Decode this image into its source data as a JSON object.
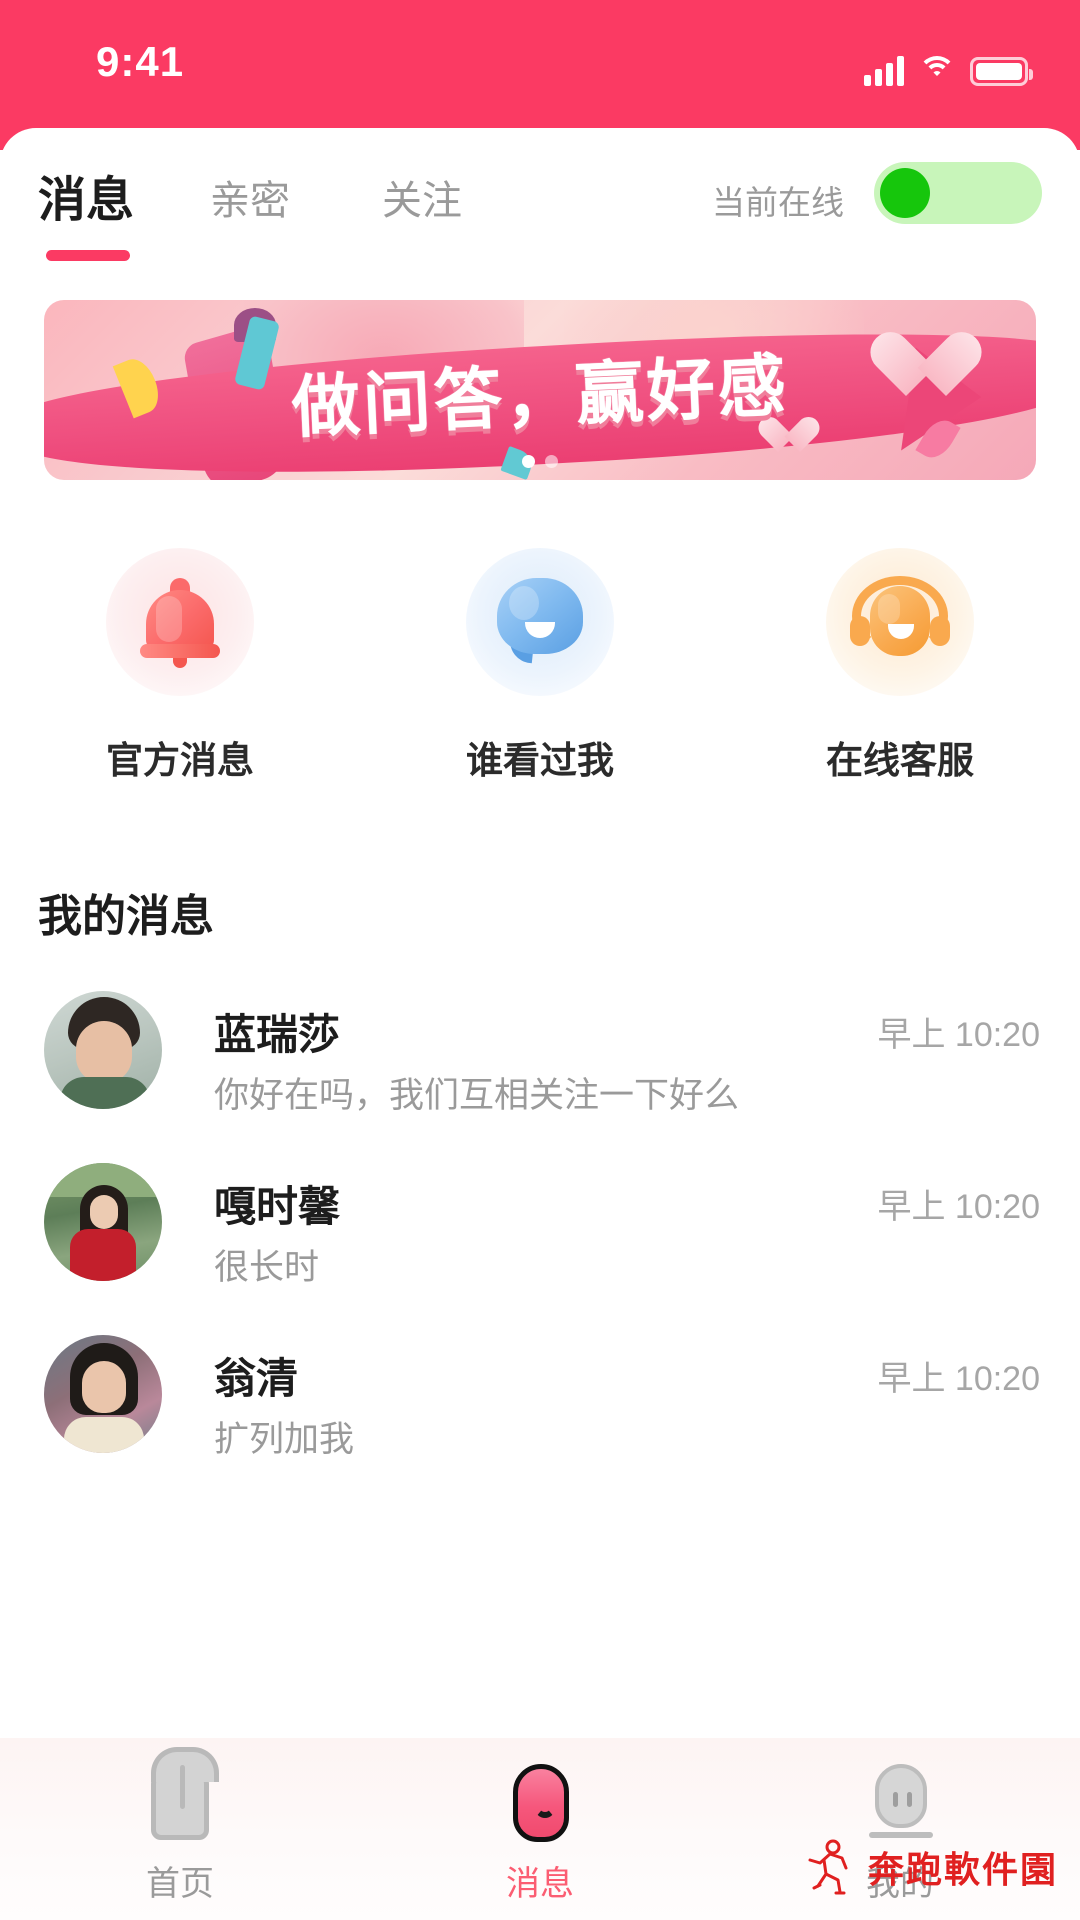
{
  "status_bar": {
    "time": "9:41",
    "signal_icon": "cellular-signal-icon",
    "wifi_icon": "wifi-icon",
    "battery_icon": "battery-icon",
    "background_color": "#fb3a63"
  },
  "tabs": [
    {
      "label": "消息",
      "active": true
    },
    {
      "label": "亲密",
      "active": false
    },
    {
      "label": "关注",
      "active": false
    }
  ],
  "online_toggle": {
    "label": "当前在线",
    "state": "on",
    "track_color": "#c8f5ba",
    "knob_color": "#16c60c"
  },
  "banner": {
    "text": "做问答，赢好感",
    "dots": [
      true,
      false
    ],
    "accent_color": "#ef4f7f"
  },
  "quick_entries": [
    {
      "label": "官方消息",
      "icon": "bell-icon"
    },
    {
      "label": "谁看过我",
      "icon": "chat-bubble-icon"
    },
    {
      "label": "在线客服",
      "icon": "headset-support-icon"
    }
  ],
  "my_messages": {
    "title": "我的消息",
    "items": [
      {
        "name": "蓝瑞莎",
        "preview": "你好在吗，我们互相关注一下好么",
        "time": "早上 10:20",
        "avatar": "avatar-lanruisha"
      },
      {
        "name": "嘎时馨",
        "preview": "很长时",
        "time": "早上 10:20",
        "avatar": "avatar-gashixin"
      },
      {
        "name": "翁清",
        "preview": "扩列加我",
        "time": "早上 10:20",
        "avatar": "avatar-wengqing"
      }
    ]
  },
  "bottom_nav": {
    "items": [
      {
        "label": "首页",
        "icon": "home-icon",
        "active": false
      },
      {
        "label": "消息",
        "icon": "message-icon",
        "active": true
      },
      {
        "label": "我的",
        "icon": "profile-icon",
        "active": false
      }
    ],
    "active_color": "#fb5d72",
    "inactive_color": "#9a9a9a"
  },
  "watermark": {
    "text": "奔跑軟件園",
    "icon": "running-person-icon",
    "color": "#e02020"
  }
}
